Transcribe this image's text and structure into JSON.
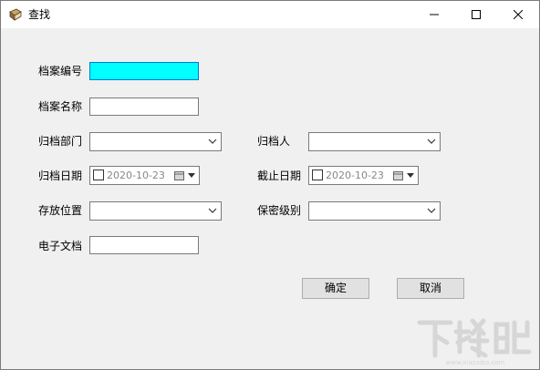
{
  "window": {
    "title": "查找"
  },
  "fields": {
    "archive_no": {
      "label": "档案编号",
      "value": ""
    },
    "archive_name": {
      "label": "档案名称",
      "value": ""
    },
    "department": {
      "label": "归档部门",
      "value": ""
    },
    "archivist": {
      "label": "归档人",
      "value": ""
    },
    "archive_date": {
      "label": "归档日期",
      "value": "2020-10-23"
    },
    "deadline_date": {
      "label": "截止日期",
      "value": "2020-10-23"
    },
    "location": {
      "label": "存放位置",
      "value": ""
    },
    "secrecy_level": {
      "label": "保密级别",
      "value": ""
    },
    "e_document": {
      "label": "电子文档",
      "value": ""
    }
  },
  "buttons": {
    "ok": "确定",
    "cancel": "取消"
  },
  "watermark": {
    "text": "下载吧",
    "url": "www.xiazaiba.com"
  },
  "colors": {
    "focus_fill": "#00ffff",
    "focus_border": "#0078d7",
    "window_bg": "#f0f0f0"
  }
}
